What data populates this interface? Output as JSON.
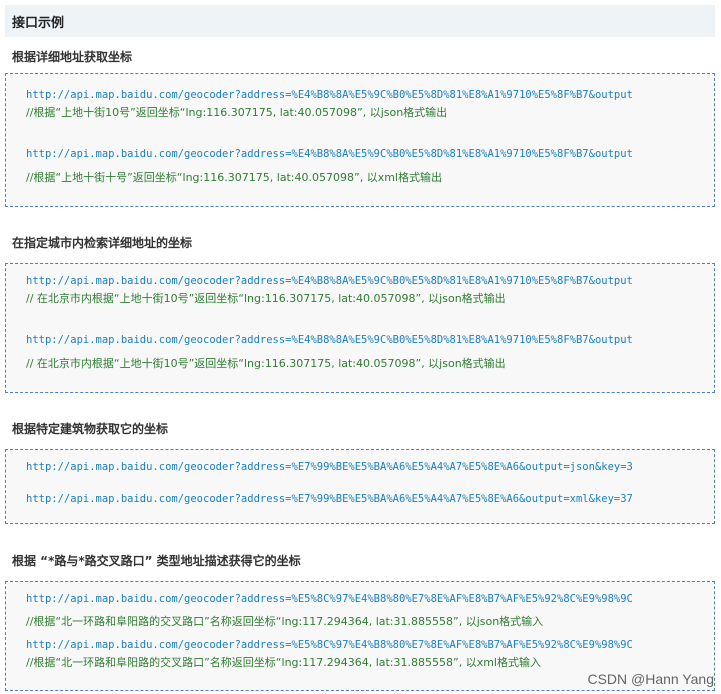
{
  "header": {
    "title": "接口示例"
  },
  "sections": [
    {
      "title": "根据详细地址获取坐标",
      "lines": [
        {
          "kind": "url",
          "text": "http://api.map.baidu.com/geocoder?address=%E4%B8%8A%E5%9C%B0%E5%8D%81%E8%A1%9710%E5%8F%B7&output"
        },
        {
          "kind": "comment",
          "text": "//根据“上地十街10号”返回坐标“lng:116.307175, lat:40.057098”, 以json格式输出"
        },
        {
          "kind": "url",
          "text": "http://api.map.baidu.com/geocoder?address=%E4%B8%8A%E5%9C%B0%E5%8D%81%E8%A1%9710%E5%8F%B7&output"
        },
        {
          "kind": "comment",
          "text": "//根据“上地十街十号”返回坐标“lng:116.307175, lat:40.057098”, 以xml格式输出"
        }
      ]
    },
    {
      "title": "在指定城市内检索详细地址的坐标",
      "lines": [
        {
          "kind": "url",
          "text": "http://api.map.baidu.com/geocoder?address=%E4%B8%8A%E5%9C%B0%E5%8D%81%E8%A1%9710%E5%8F%B7&output"
        },
        {
          "kind": "comment",
          "text": "// 在北京市内根据“上地十街10号”返回坐标“lng:116.307175, lat:40.057098”, 以json格式输出"
        },
        {
          "kind": "url",
          "text": "http://api.map.baidu.com/geocoder?address=%E4%B8%8A%E5%9C%B0%E5%8D%81%E8%A1%9710%E5%8F%B7&output"
        },
        {
          "kind": "comment",
          "text": "// 在北京市内根据“上地十街10号”返回坐标“lng:116.307175, lat:40.057098”, 以json格式输出"
        }
      ]
    },
    {
      "title": "根据特定建筑物获取它的坐标",
      "lines": [
        {
          "kind": "url",
          "text": "http://api.map.baidu.com/geocoder?address=%E7%99%BE%E5%BA%A6%E5%A4%A7%E5%8E%A6&output=json&key=3"
        },
        {
          "kind": "url",
          "text": "http://api.map.baidu.com/geocoder?address=%E7%99%BE%E5%BA%A6%E5%A4%A7%E5%8E%A6&output=xml&key=37"
        }
      ]
    },
    {
      "title": "根据 “*路与*路交叉路口” 类型地址描述获得它的坐标",
      "lines": [
        {
          "kind": "url",
          "text": "http://api.map.baidu.com/geocoder?address=%E5%8C%97%E4%B8%80%E7%8E%AF%E8%B7%AF%E5%92%8C%E9%98%9C"
        },
        {
          "kind": "comment",
          "text": "//根据“北一环路和阜阳路的交叉路口”名称返回坐标“lng:117.294364, lat:31.885558”, 以json格式输入"
        },
        {
          "kind": "url",
          "text": "http://api.map.baidu.com/geocoder?address=%E5%8C%97%E4%B8%80%E7%8E%AF%E8%B7%AF%E5%92%8C%E9%98%9C"
        },
        {
          "kind": "comment",
          "text": "//根据“北一环路和阜阳路的交叉路口”名称返回坐标“lng:117.294364, lat:31.885558”, 以xml格式输入"
        }
      ]
    }
  ],
  "watermark": "CSDN @Hann Yang"
}
